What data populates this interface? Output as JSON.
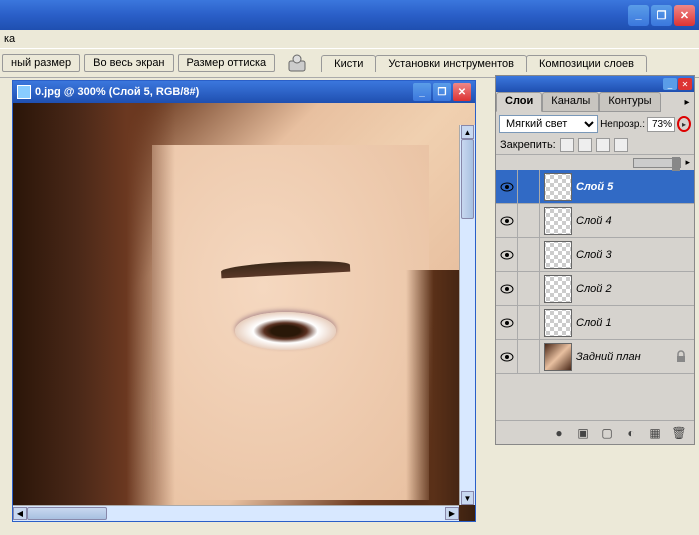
{
  "menubar": {
    "item": "ка"
  },
  "toolbar": {
    "btn1": "ный размер",
    "btn2": "Во весь экран",
    "btn3": "Размер оттиска",
    "tab1": "Кисти",
    "tab2": "Установки инструментов",
    "tab3": "Композиции слоев"
  },
  "doc": {
    "title": "0.jpg @ 300% (Слой 5, RGB/8#)"
  },
  "layers": {
    "tabs": {
      "t1": "Слои",
      "t2": "Каналы",
      "t3": "Контуры"
    },
    "blend": "Мягкий свет",
    "opacity_label": "Непрозр.:",
    "opacity_value": "73%",
    "lock_label": "Закрепить:",
    "items": [
      {
        "name": "Слой 5"
      },
      {
        "name": "Слой 4"
      },
      {
        "name": "Слой 3"
      },
      {
        "name": "Слой 2"
      },
      {
        "name": "Слой 1"
      },
      {
        "name": "Задний план"
      }
    ]
  }
}
